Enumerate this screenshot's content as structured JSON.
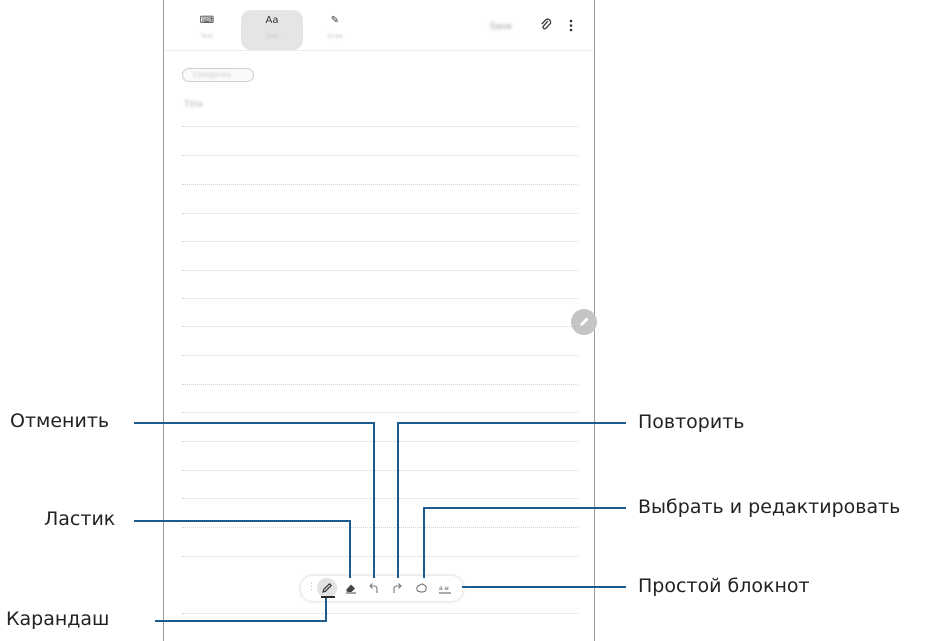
{
  "app": {
    "tabs": [
      {
        "icon": "keyboard-icon",
        "label": "Text",
        "glyph": "⌨"
      },
      {
        "icon": "handwriting-icon",
        "label": "Text",
        "glyph": "Aa"
      },
      {
        "icon": "drawing-icon",
        "label": "Draw",
        "glyph": "✎"
      }
    ],
    "toolbar_right": {
      "save_label": "Save",
      "attach_icon": "paperclip-icon",
      "more_icon": "more-vert-icon"
    },
    "category_placeholder": "Categories",
    "title_placeholder": "Title"
  },
  "drawing_toolbar": {
    "tools": [
      {
        "name": "pen",
        "icon": "pen-icon"
      },
      {
        "name": "eraser",
        "icon": "eraser-icon"
      },
      {
        "name": "undo",
        "icon": "undo-icon"
      },
      {
        "name": "redo",
        "icon": "redo-icon"
      },
      {
        "name": "selection",
        "icon": "lasso-icon"
      },
      {
        "name": "simple-notebook",
        "icon": "simple-notebook-icon"
      }
    ]
  },
  "callouts": {
    "undo": "Отменить",
    "eraser": "Ластик",
    "pencil": "Карандаш",
    "redo": "Повторить",
    "select_edit": "Выбрать и редактировать",
    "simple_notebook": "Простой блокнот"
  },
  "colors": {
    "leader": "#1e5a8c",
    "frame": "#9a9a9a",
    "active_tab": "#e5e5e5"
  }
}
